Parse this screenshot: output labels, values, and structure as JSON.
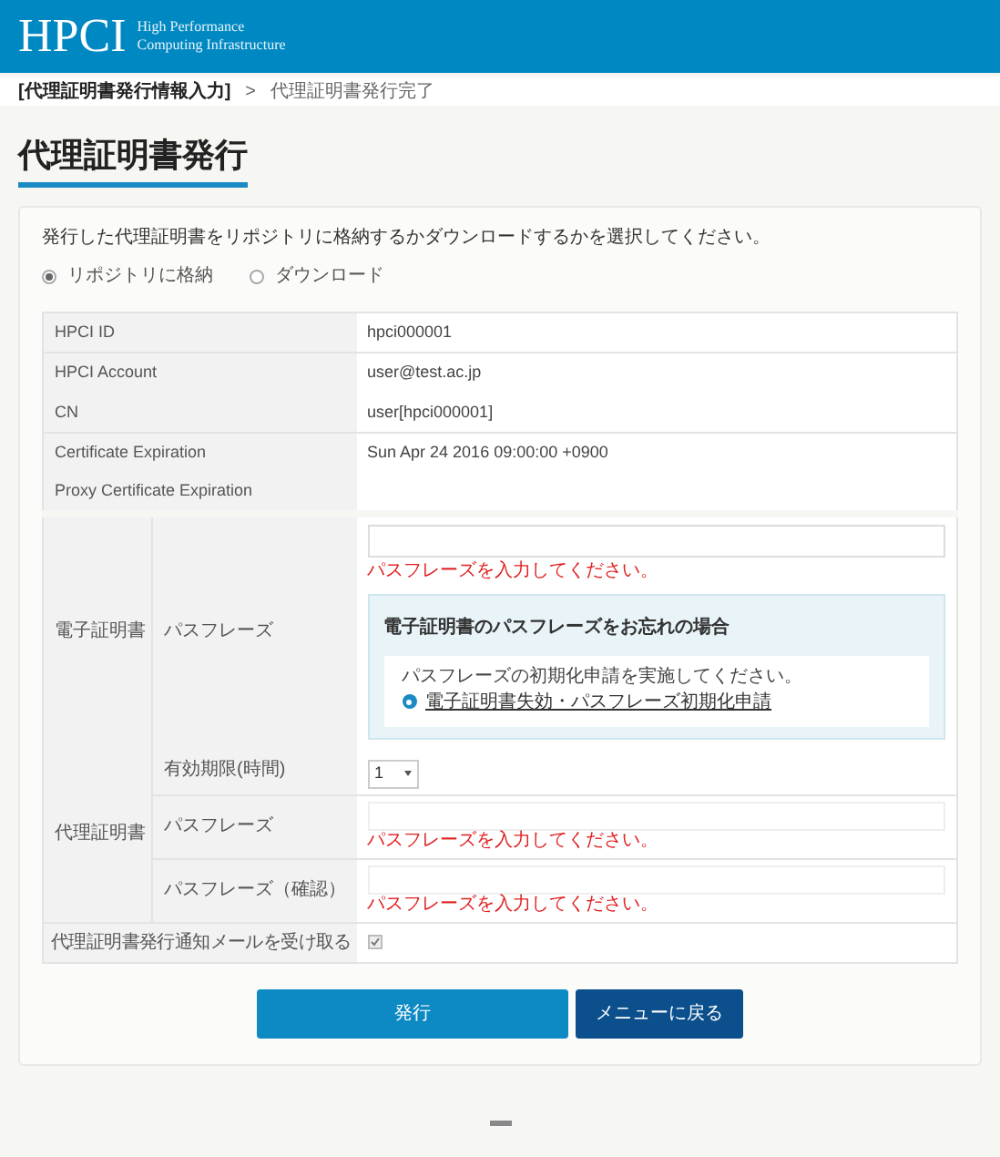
{
  "header": {
    "logo": "HPCI",
    "subtitle": [
      "High Performance",
      "Computing Infrastructure"
    ]
  },
  "breadcrumb": [
    {
      "label": "[代理証明書発行情報入力]",
      "selected": true
    },
    {
      "label": ">",
      "selected": false
    },
    {
      "label": "代理証明書発行完了",
      "selected": false
    }
  ],
  "title": "代理証明書発行",
  "intro": "発行した代理証明書をリポジトリに格納するかダウンロードするかを選択してください。",
  "options": [
    {
      "label": "リポジトリに格納",
      "selected": true
    },
    {
      "label": "ダウンロード",
      "selected": false
    }
  ],
  "info_sections": [
    [
      {
        "label": "HPCI ID",
        "value": "hpci000001"
      }
    ],
    [
      {
        "label": "HPCI Account",
        "value": "user@test.ac.jp"
      },
      {
        "label": "CN",
        "value": "user[hpci000001]"
      }
    ],
    [
      {
        "label": "Certificate Expiration",
        "value": "Sun Apr 24 2016 09:00:00 +0900"
      },
      {
        "label": "Proxy Certificate Expiration"
      }
    ]
  ],
  "e_certificate": {
    "label": "電子証明書",
    "field_label": "パスフレーズ",
    "error": "パスフレーズを入力してください。",
    "notice": {
      "title": "電子証明書のパスフレーズをお忘れの場合",
      "text": "パスフレーズの初期化申請を実施してください。",
      "link": "電子証明書失効・パスフレーズ初期化申請"
    }
  },
  "proxy_certificate": {
    "label": "代理証明書",
    "rows": [
      {
        "kind": "select",
        "label": "有効期限(時間)",
        "value": "1"
      },
      {
        "kind": "password",
        "label": "パスフレーズ",
        "error": "パスフレーズを入力してください。"
      },
      {
        "kind": "password",
        "label": "パスフレーズ（確認）",
        "error": "パスフレーズを入力してください。"
      }
    ]
  },
  "mail": {
    "label": "代理証明書発行通知メールを受け取る",
    "checked": true
  },
  "buttons": [
    {
      "label": "発行",
      "kind": "primary"
    },
    {
      "label": "メニューに戻る",
      "kind": "secondary"
    }
  ]
}
